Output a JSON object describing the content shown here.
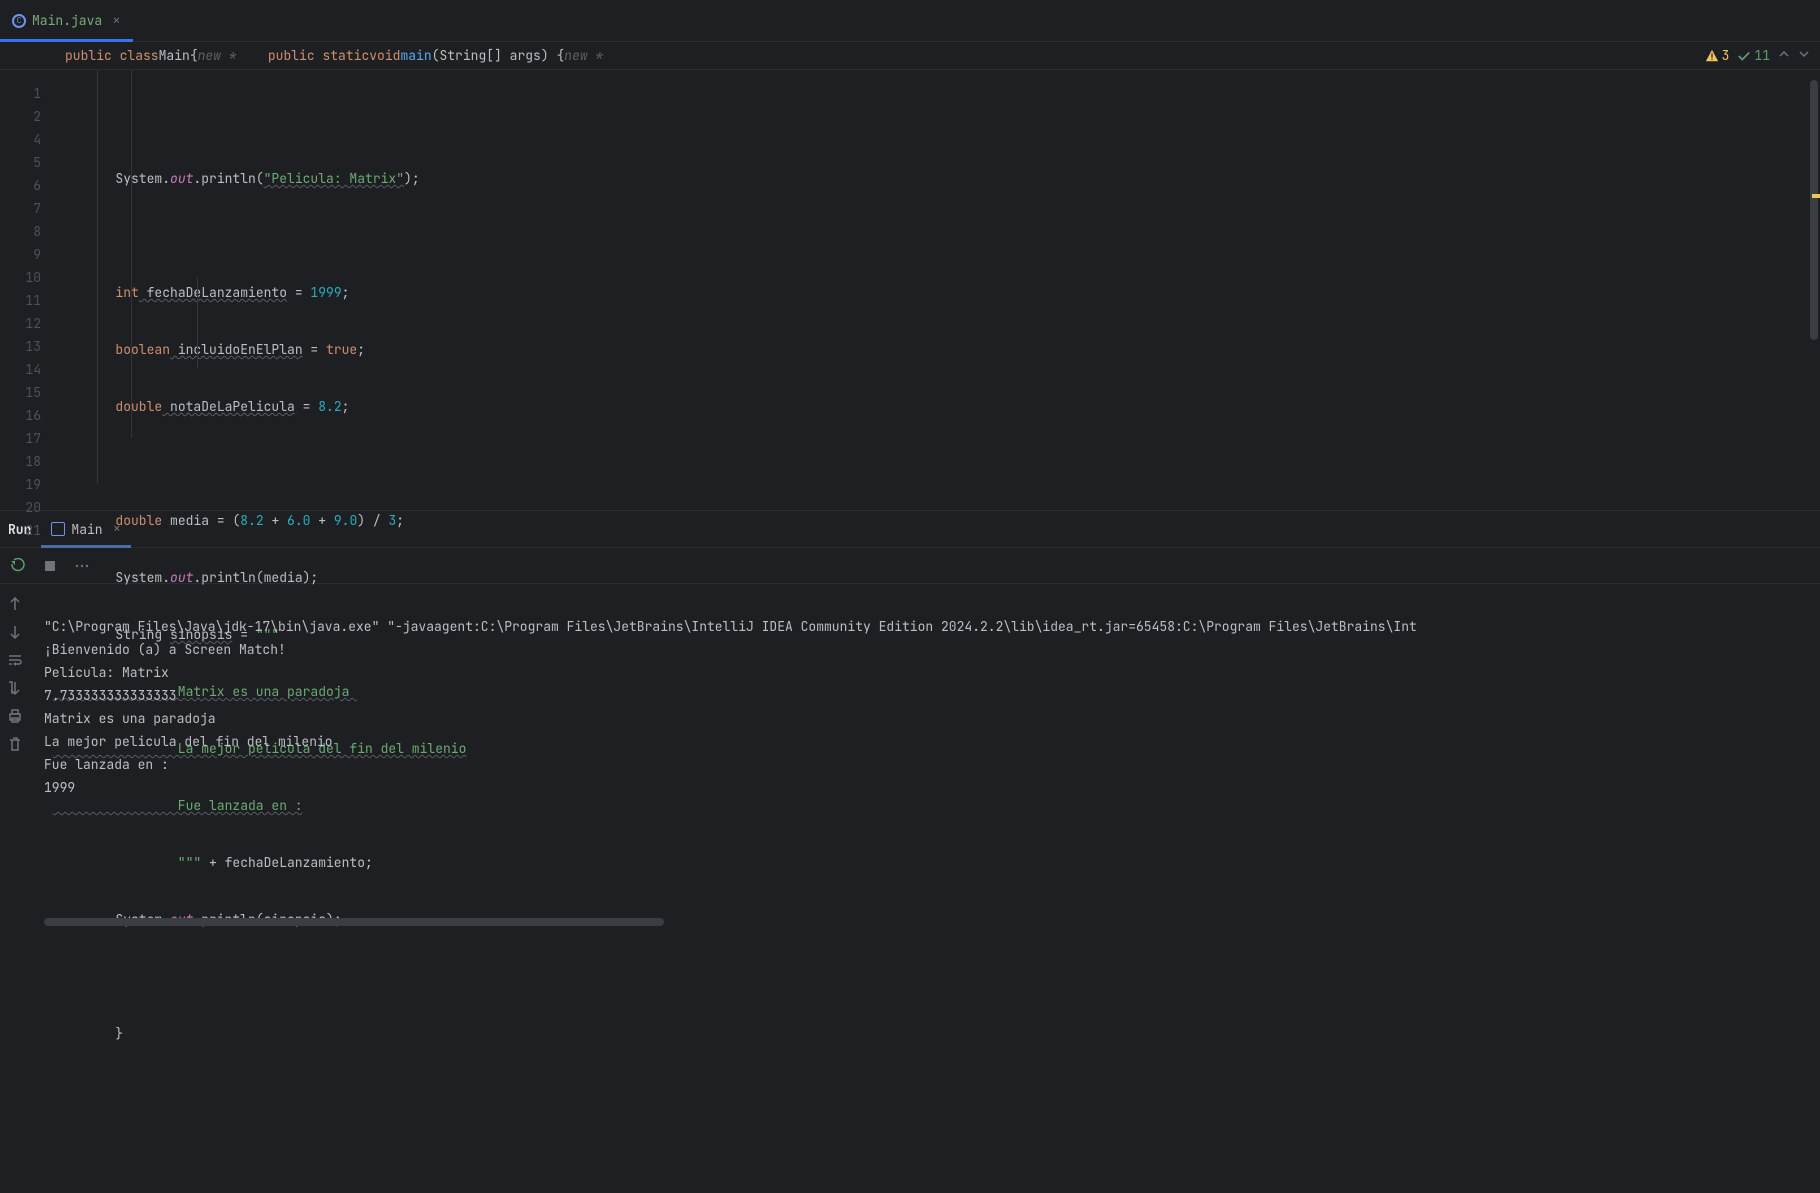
{
  "tab": {
    "filename": "Main.java"
  },
  "breadcrumb": {
    "class_kw": "public class ",
    "class_name": "Main",
    "class_brace": " {",
    "class_hint": "  new *",
    "method_kw1": "public static ",
    "method_kw2": "void ",
    "method_name": "main",
    "method_params": "(String[] args) {",
    "method_hint": "  new *"
  },
  "inspections": {
    "warnings": "3",
    "checks": "11"
  },
  "gutter": [
    "1",
    "2",
    "4",
    "5",
    "6",
    "7",
    "8",
    "9",
    "10",
    "11",
    "12",
    "13",
    "14",
    "15",
    "16",
    "17",
    "18",
    "19",
    "20",
    "21"
  ],
  "code": {
    "l4": {
      "p1": "        System.",
      "out": "out",
      "p2": ".println(",
      "str": "\"Pelicula: Matrix\"",
      "p3": ");"
    },
    "l6": {
      "kw": "int",
      "var": " fechaDeLanzamiento",
      "eq": " = ",
      "num": "1999",
      "sc": ";"
    },
    "l7": {
      "kw": "boolean",
      "var": " incluidoEnElPlan",
      "eq": " = ",
      "val": "true",
      "sc": ";"
    },
    "l8": {
      "kw": "double",
      "var": " notaDeLaPelicula",
      "eq": " = ",
      "num": "8.2",
      "sc": ";"
    },
    "l10": {
      "kw": "double",
      "var": " media",
      "eq": " = (",
      "n1": "8.2",
      "op1": " + ",
      "n2": "6.0",
      "op2": " + ",
      "n3": "9.0",
      "cp": ") / ",
      "n4": "3",
      "sc": ";"
    },
    "l11": {
      "p1": "        System.",
      "out": "out",
      "p2": ".println(media);"
    },
    "l12": {
      "p1": "        String ",
      "var": "sinopsis",
      "eq": " = ",
      "q": "\"\"\""
    },
    "l13": {
      "txt": "                Matrix es una paradoja "
    },
    "l14": {
      "txt": "                La mejor pelicula del fin del milenio"
    },
    "l15": {
      "txt": "                Fue lanzada en :"
    },
    "l16": {
      "q": "                \"\"\"",
      "p": " + fechaDeLanzamiento;"
    },
    "l17": {
      "p1": "        System.",
      "out": "out",
      "p2": ".println(sinopsis);"
    },
    "l19": {
      "p": "        }"
    }
  },
  "run": {
    "panel_label": "Run",
    "tab_name": "Main"
  },
  "console": {
    "line1": "\"C:\\Program Files\\Java\\jdk-17\\bin\\java.exe\" \"-javaagent:C:\\Program Files\\JetBrains\\IntelliJ IDEA Community Edition 2024.2.2\\lib\\idea_rt.jar=65458:C:\\Program Files\\JetBrains\\Int",
    "line2": "¡Bienvenido (a) a Screen Match!",
    "line3": "Película: Matrix",
    "line4": "7.733333333333333",
    "line5": "Matrix es una paradoja",
    "line6": "La mejor pelicula del fin del milenio",
    "line7": "Fue lanzada en :",
    "line8": "1999"
  }
}
